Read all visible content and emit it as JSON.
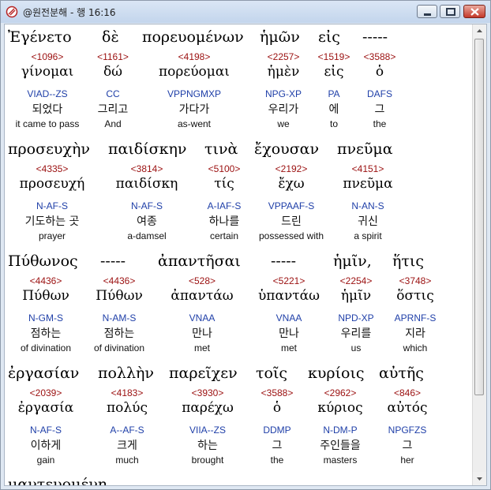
{
  "window": {
    "title": "@원전분해 - 행 16:16"
  },
  "rows": [
    {
      "greek": [
        "Ἐγένετο",
        "δὲ",
        "πορευομένων",
        "ἡμῶν",
        "εἰς",
        "-----"
      ],
      "cells": [
        {
          "strong": "<1096>",
          "lemma": "γίνομαι",
          "parse": "VIAD--ZS",
          "korean": "되었다",
          "english": "it came to pass"
        },
        {
          "strong": "<1161>",
          "lemma": "δώ",
          "parse": "CC",
          "korean": "그리고",
          "english": "And"
        },
        {
          "strong": "<4198>",
          "lemma": "πορεύομαι",
          "parse": "VPPNGMXP",
          "korean": "가다가",
          "english": "as-went"
        },
        {
          "strong": "<2257>",
          "lemma": "ἡμὲν",
          "parse": "NPG-XP",
          "korean": "우리가",
          "english": "we"
        },
        {
          "strong": "<1519>",
          "lemma": "εἰς",
          "parse": "PA",
          "korean": "에",
          "english": "to"
        },
        {
          "strong": "<3588>",
          "lemma": "ὁ",
          "parse": "DAFS",
          "korean": "그",
          "english": "the"
        }
      ]
    },
    {
      "greek": [
        "προσευχὴν",
        "παιδίσκην",
        "τινὰ",
        "ἔχουσαν",
        "πνεῦμα"
      ],
      "cells": [
        {
          "strong": "<4335>",
          "lemma": "προσευχή",
          "parse": "N-AF-S",
          "korean": "기도하는 곳",
          "english": "prayer"
        },
        {
          "strong": "<3814>",
          "lemma": "παιδίσκη",
          "parse": "N-AF-S",
          "korean": "여종",
          "english": "a-damsel"
        },
        {
          "strong": "<5100>",
          "lemma": "τίς",
          "parse": "A-IAF-S",
          "korean": "하나를",
          "english": "certain"
        },
        {
          "strong": "<2192>",
          "lemma": "ἔχω",
          "parse": "VPPAAF-S",
          "korean": "드린",
          "english": "possessed with"
        },
        {
          "strong": "<4151>",
          "lemma": "πνεῦμα",
          "parse": "N-AN-S",
          "korean": "귀신",
          "english": "a spirit"
        }
      ]
    },
    {
      "greek": [
        "Πύθωνος",
        "-----",
        "ἀπαντῆσαι",
        "-----",
        "ἡμῖν,",
        "ἥτις"
      ],
      "cells": [
        {
          "strong": "<4436>",
          "lemma": "Πύθων",
          "parse": "N-GM-S",
          "korean": "점하는",
          "english": "of divination"
        },
        {
          "strong": "<4436>",
          "lemma": "Πύθων",
          "parse": "N-AM-S",
          "korean": "점하는",
          "english": "of divination"
        },
        {
          "strong": "<528>",
          "lemma": "ἀπαντάω",
          "parse": "VNAA",
          "korean": "만나",
          "english": "met"
        },
        {
          "strong": "<5221>",
          "lemma": "ὑπαντάω",
          "parse": "VNAA",
          "korean": "만나",
          "english": "met"
        },
        {
          "strong": "<2254>",
          "lemma": "ἡμῖν",
          "parse": "NPD-XP",
          "korean": "우리를",
          "english": "us"
        },
        {
          "strong": "<3748>",
          "lemma": "ὅστις",
          "parse": "APRNF-S",
          "korean": "지라",
          "english": "which"
        }
      ]
    },
    {
      "greek": [
        "ἐργασίαν",
        "πολλὴν",
        "παρεῖχεν",
        "τοῖς",
        "κυρίοις",
        "αὐτῆς"
      ],
      "cells": [
        {
          "strong": "<2039>",
          "lemma": "ἐργασία",
          "parse": "N-AF-S",
          "korean": "이하게",
          "english": "gain"
        },
        {
          "strong": "<4183>",
          "lemma": "πολύς",
          "parse": "A--AF-S",
          "korean": "크게",
          "english": "much"
        },
        {
          "strong": "<3930>",
          "lemma": "παρέχω",
          "parse": "VIIA--ZS",
          "korean": "하는",
          "english": "brought"
        },
        {
          "strong": "<3588>",
          "lemma": "ὁ",
          "parse": "DDMP",
          "korean": "그",
          "english": "the"
        },
        {
          "strong": "<2962>",
          "lemma": "κύριος",
          "parse": "N-DM-P",
          "korean": "주인들을",
          "english": "masters"
        },
        {
          "strong": "<846>",
          "lemma": "αὐτός",
          "parse": "NPGFZS",
          "korean": "그",
          "english": "her"
        }
      ]
    },
    {
      "greek": [
        "μαντευομένη"
      ]
    }
  ],
  "colors": {
    "strong": "#9b1010",
    "parse": "#1f3fa8",
    "titlebar": "#c3d5ec"
  }
}
